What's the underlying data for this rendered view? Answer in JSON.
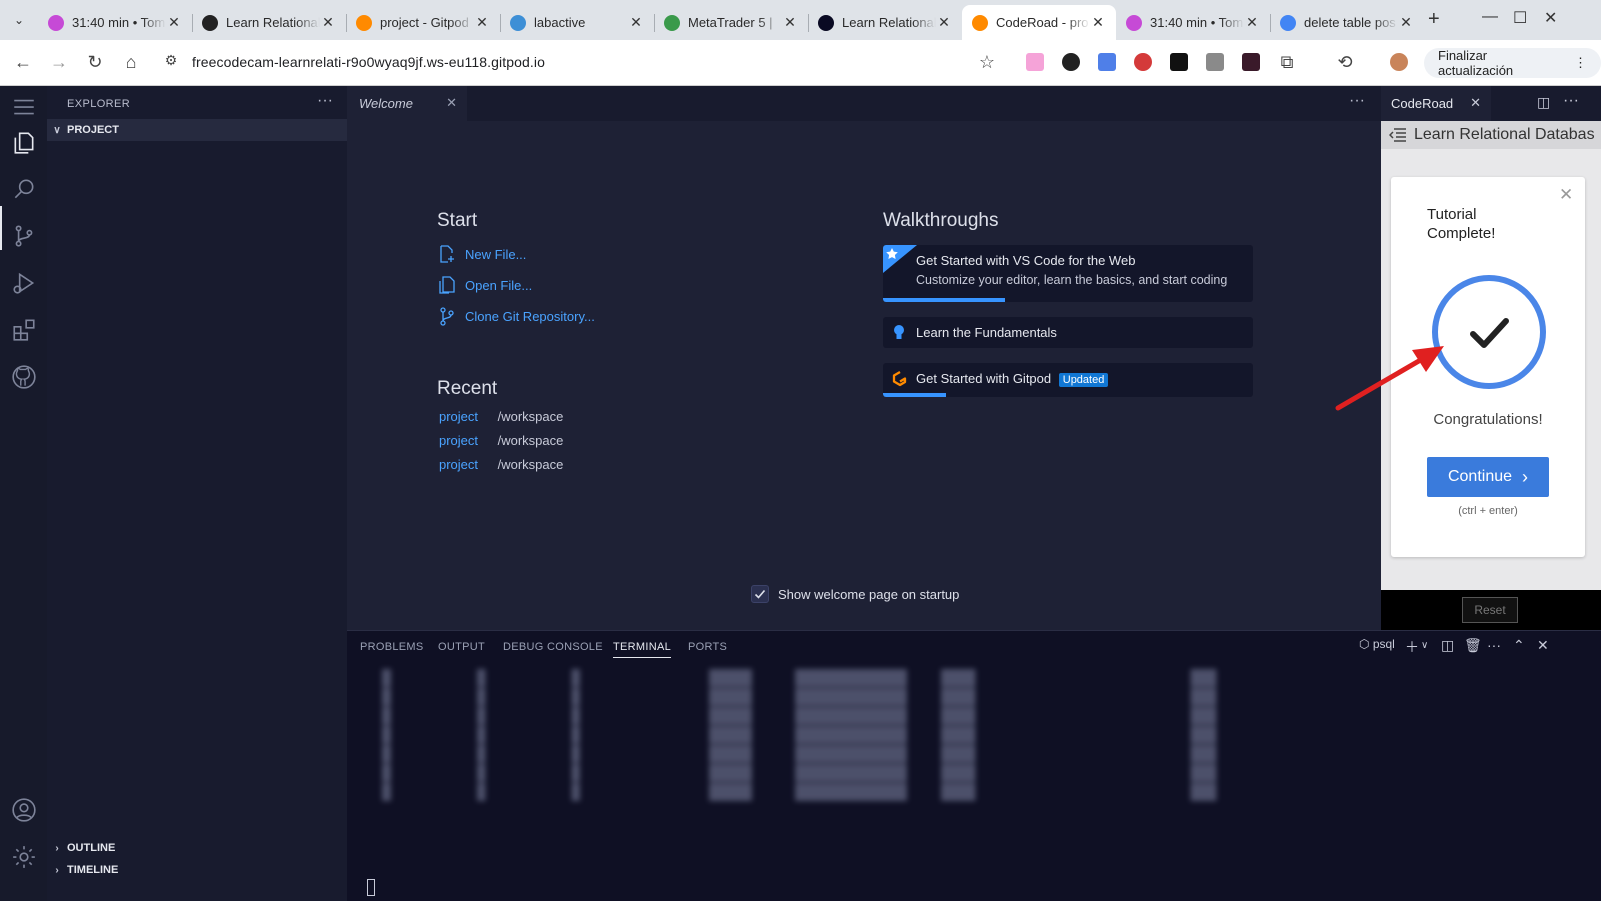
{
  "browser": {
    "tabs": [
      {
        "title": "31:40 min • Tom",
        "favicon_color": "#c64ad6",
        "active": false
      },
      {
        "title": "Learn Relational",
        "favicon_color": "#222222",
        "active": false
      },
      {
        "title": "project - Gitpod",
        "favicon_color": "#ff8a00",
        "active": false
      },
      {
        "title": "labactive",
        "favicon_color": "#3d8fd6",
        "active": false
      },
      {
        "title": "MetaTrader 5 |",
        "favicon_color": "#3a9a4b",
        "active": false
      },
      {
        "title": "Learn Relational",
        "favicon_color": "#0a0a23",
        "active": false
      },
      {
        "title": "CodeRoad - pro",
        "favicon_color": "#ff8a00",
        "active": true
      },
      {
        "title": "31:40 min • Tom",
        "favicon_color": "#c64ad6",
        "active": false
      },
      {
        "title": "delete table pos",
        "favicon_color": "#4285f4",
        "active": false
      }
    ],
    "new_tab_icon": "plus-icon",
    "url": "freecodecam-learnrelati-r9o0wyaq9jf.ws-eu118.gitpod.io",
    "update_button": "Finalizar actualización"
  },
  "explorer": {
    "title": "EXPLORER",
    "project_section": "PROJECT",
    "outline_section": "OUTLINE",
    "timeline_section": "TIMELINE"
  },
  "editor": {
    "tab_label": "Welcome",
    "start": {
      "heading": "Start",
      "new_file": "New File...",
      "open_file": "Open File...",
      "clone_repo": "Clone Git Repository..."
    },
    "recent": {
      "heading": "Recent",
      "items": [
        {
          "name": "project",
          "path": "/workspace"
        },
        {
          "name": "project",
          "path": "/workspace"
        },
        {
          "name": "project",
          "path": "/workspace"
        }
      ]
    },
    "walkthroughs": {
      "heading": "Walkthroughs",
      "items": [
        {
          "title": "Get Started with VS Code for the Web",
          "description": "Customize your editor, learn the basics, and start coding",
          "progress": 0.33
        },
        {
          "title": "Learn the Fundamentals",
          "progress": 0
        },
        {
          "title": "Get Started with Gitpod",
          "badge": "Updated",
          "progress": 0.17
        }
      ]
    },
    "show_on_startup": "Show welcome page on startup"
  },
  "panel": {
    "tabs": [
      "PROBLEMS",
      "OUTPUT",
      "DEBUG CONSOLE",
      "TERMINAL",
      "PORTS"
    ],
    "active_tab": "TERMINAL",
    "terminal_name": "psql"
  },
  "coderoad": {
    "tab_label": "CodeRoad",
    "tutorial_title": "Learn Relational Databas",
    "complete_title": "Tutorial Complete!",
    "congrats": "Congratulations!",
    "continue_label": "Continue",
    "shortcut_hint": "(ctrl + enter)",
    "reset_label": "Reset"
  },
  "colors": {
    "accent": "#3794ff",
    "link": "#4aa3ff",
    "continue": "#3a7bdc",
    "progress_ring": "#4a86e8",
    "annotation_arrow": "#e02020"
  }
}
